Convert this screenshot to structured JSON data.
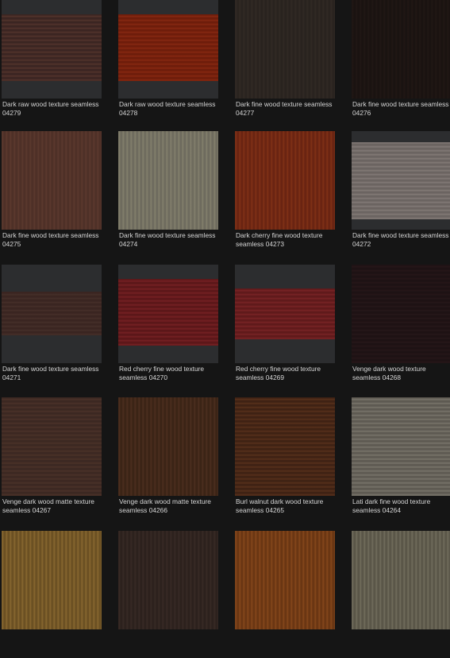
{
  "tiles": [
    {
      "title": "Dark raw wood texture seamless",
      "code": "04279",
      "colors": {
        "base": "#3b2522",
        "hi": "#55352c",
        "frame": "#2c2d2f"
      },
      "framed": true,
      "band": [
        18,
        102
      ]
    },
    {
      "title": "Dark raw wood texture seamless",
      "code": "04278",
      "colors": {
        "base": "#6e1d0b",
        "hi": "#8a2a12",
        "frame": "#2c2d2f"
      },
      "framed": true,
      "band": [
        18,
        102
      ]
    },
    {
      "title": "Dark fine wood texture seamless",
      "code": "04277",
      "colors": {
        "base": "#29231f",
        "hi": "#332b26",
        "frame": "#29231f"
      },
      "framed": false
    },
    {
      "title": "Dark fine wood texture seamless",
      "code": "04276",
      "colors": {
        "base": "#1a1311",
        "hi": "#221815",
        "frame": "#1a1311"
      },
      "framed": false
    },
    {
      "title": "Dark fine wood texture seamless",
      "code": "04275",
      "colors": {
        "base": "#4e3027",
        "hi": "#5e3a2f",
        "frame": "#4e3027"
      },
      "framed": false
    },
    {
      "title": "Dark fine wood texture seamless",
      "code": "04274",
      "colors": {
        "base": "#6e6b5e",
        "hi": "#87836f",
        "frame": "#6e6b5e"
      },
      "framed": false
    },
    {
      "title": "Dark cherry fine wood texture",
      "code": "seamless 04273",
      "colors": {
        "base": "#6a2412",
        "hi": "#843317",
        "frame": "#6a2412"
      },
      "framed": false
    },
    {
      "title": "Dark fine wood texture seamless",
      "code": "04272",
      "colors": {
        "base": "#6b6461",
        "hi": "#857d79",
        "frame": "#2c2d2f"
      },
      "framed": true,
      "band": [
        14,
        111
      ]
    },
    {
      "title": "Dark fine wood texture seamless",
      "code": "04271",
      "colors": {
        "base": "#3a2521",
        "hi": "#47302a",
        "frame": "#2c2d2f"
      },
      "framed": true,
      "band": [
        34,
        89
      ]
    },
    {
      "title": "Red cherry fine wood texture",
      "code": "seamless 04270",
      "colors": {
        "base": "#5c1719",
        "hi": "#7a2124",
        "frame": "#2c2d2f"
      },
      "framed": true,
      "band": [
        18,
        102
      ]
    },
    {
      "title": "Red cherry fine wood texture",
      "code": "seamless 04269",
      "colors": {
        "base": "#601a1b",
        "hi": "#7c2426",
        "frame": "#2c2d2f"
      },
      "framed": true,
      "band": [
        30,
        94
      ]
    },
    {
      "title": "Venge dark wood texture",
      "code": "seamless 04268",
      "colors": {
        "base": "#1e1214",
        "hi": "#27181a",
        "frame": "#1e1214"
      },
      "framed": false
    },
    {
      "title": "Venge dark wood matte texture",
      "code": "seamless 04267",
      "colors": {
        "base": "#3c2822",
        "hi": "#4d3329",
        "frame": "#3c2822"
      },
      "framed": false
    },
    {
      "title": "Venge dark wood matte texture",
      "code": "seamless 04266",
      "colors": {
        "base": "#3b2416",
        "hi": "#4f3020",
        "frame": "#3b2416"
      },
      "framed": false
    },
    {
      "title": "Burl walnut dark wood texture",
      "code": "seamless 04265",
      "colors": {
        "base": "#3f2214",
        "hi": "#5a321c",
        "frame": "#3f2214"
      },
      "framed": false
    },
    {
      "title": "Lati dark fine wood texture",
      "code": "seamless 04264",
      "colors": {
        "base": "#5e5a52",
        "hi": "#7c786d",
        "frame": "#5e5a52"
      },
      "framed": false
    },
    {
      "title": "",
      "code": "",
      "colors": {
        "base": "#6b5023",
        "hi": "#8c6b32",
        "frame": "#6b5023"
      },
      "framed": false
    },
    {
      "title": "",
      "code": "",
      "colors": {
        "base": "#2c211d",
        "hi": "#3a2c26",
        "frame": "#2c211d"
      },
      "framed": false
    },
    {
      "title": "",
      "code": "",
      "colors": {
        "base": "#6a3613",
        "hi": "#8a4a1c",
        "frame": "#6a3613"
      },
      "framed": false
    },
    {
      "title": "",
      "code": "",
      "colors": {
        "base": "#5a5648",
        "hi": "#74705f",
        "frame": "#5a5648"
      },
      "framed": false
    }
  ]
}
